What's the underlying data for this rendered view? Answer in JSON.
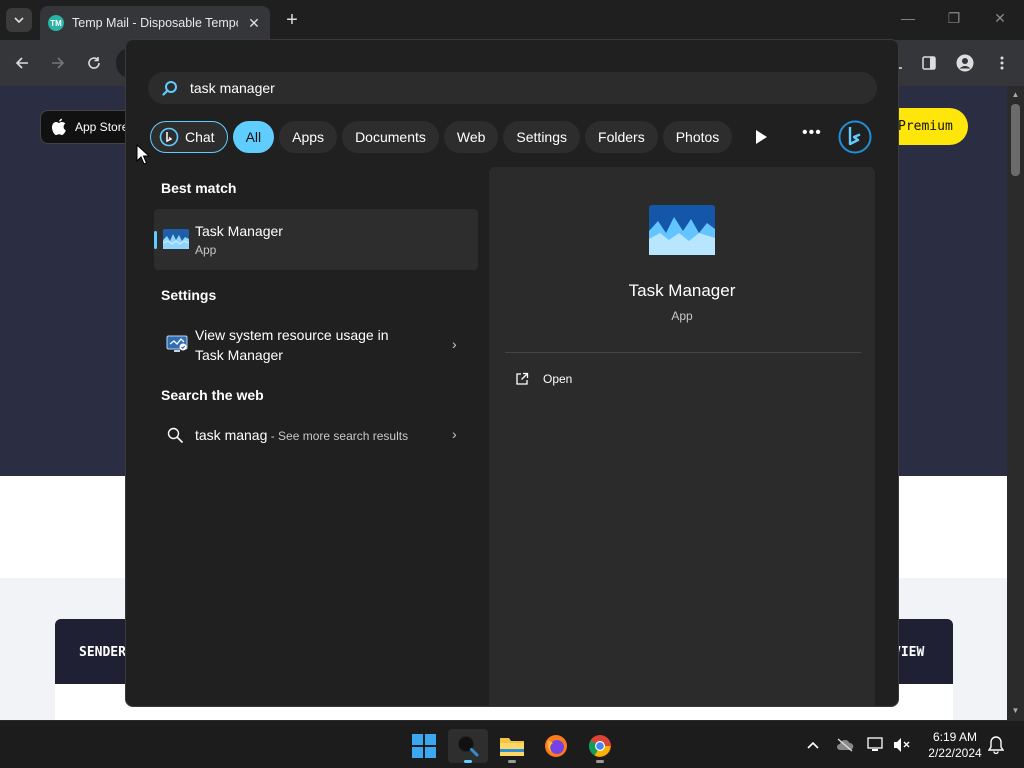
{
  "browser": {
    "tab_title": "Temp Mail - Disposable Temporary Email",
    "tab_favicon_text": "TM",
    "page": {
      "app_store_label": "App Store",
      "premium_label": "Premium",
      "inbox_columns": [
        "SENDER",
        "VIEW"
      ]
    }
  },
  "search": {
    "query": "task manager",
    "filters": {
      "chat": "Chat",
      "items": [
        "All",
        "Apps",
        "Documents",
        "Web",
        "Settings",
        "Folders",
        "Photos"
      ],
      "active": "All"
    },
    "best_match_title": "Best match",
    "best_match": {
      "name": "Task Manager",
      "type": "App"
    },
    "settings_title": "Settings",
    "settings_result": {
      "line1": "View system resource usage in",
      "line2": "Task Manager"
    },
    "web_title": "Search the web",
    "web_result": {
      "query": "task manag",
      "suffix": " - See more search results"
    },
    "preview": {
      "name": "Task Manager",
      "type": "App",
      "action_open": "Open"
    }
  },
  "taskbar": {
    "time": "6:19 AM",
    "date": "2/22/2024",
    "apps": [
      "start-icon",
      "search-icon",
      "file-explorer-icon",
      "firefox-icon",
      "chrome-icon"
    ]
  },
  "colors": {
    "accent": "#60cdff",
    "panel_bg": "#202020",
    "premium_yellow": "#ffe60a"
  }
}
